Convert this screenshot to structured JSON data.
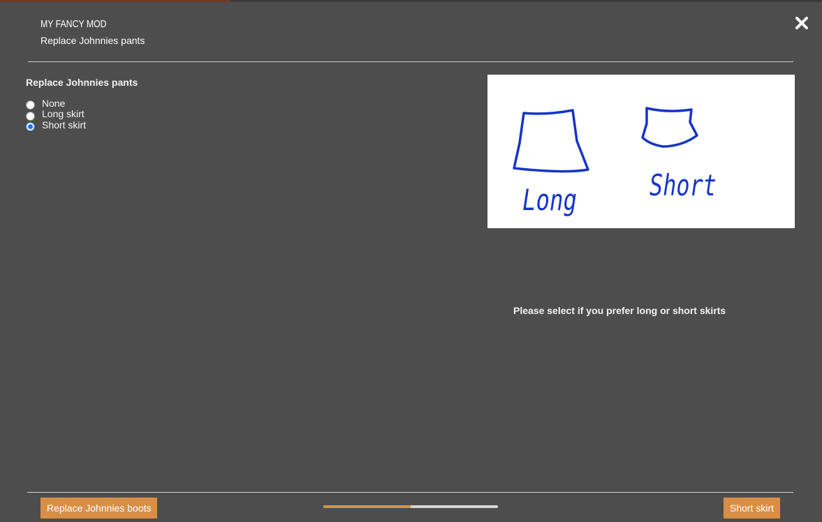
{
  "header": {
    "mod_name": "My Fancy Mod",
    "step_name": "Replace Johnnies pants"
  },
  "group": {
    "title": "Replace Johnnies pants",
    "options": [
      {
        "label": "None",
        "checked": false
      },
      {
        "label": "Long skirt",
        "checked": false
      },
      {
        "label": "Short skirt",
        "checked": true
      }
    ]
  },
  "preview": {
    "labels": [
      "Long",
      "Short"
    ],
    "ink_color": "#1533c9"
  },
  "description": "Please select if you prefer long or short skirts",
  "footer": {
    "prev_label": "Replace Johnnies boots",
    "next_label": "Short skirt",
    "progress": 0.5
  },
  "colors": {
    "background": "#4d4d4d",
    "accent": "#d88f45",
    "radio_checked": "#1a73e8"
  }
}
